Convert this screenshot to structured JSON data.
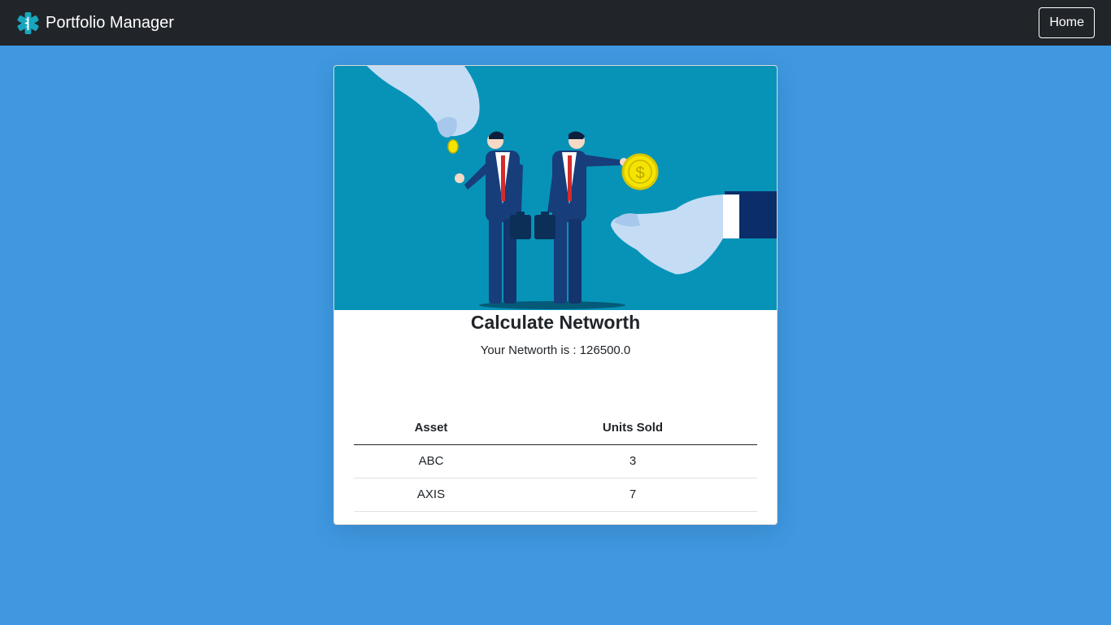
{
  "navbar": {
    "brand_name": "Portfolio Manager",
    "brand_icon": "medical-star-icon",
    "home_label": "Home"
  },
  "card": {
    "image": "business-coin-exchange-illustration",
    "title": "Calculate Networth",
    "networth_label": "Your Networth is : 126500.0"
  },
  "table": {
    "headers": [
      "Asset",
      "Units Sold"
    ],
    "rows": [
      [
        "ABC",
        "3"
      ],
      [
        "AXIS",
        "7"
      ]
    ]
  },
  "colors": {
    "page_background": "#3f98e0",
    "navbar_background": "#212529",
    "hero_background": "#0793b8"
  }
}
